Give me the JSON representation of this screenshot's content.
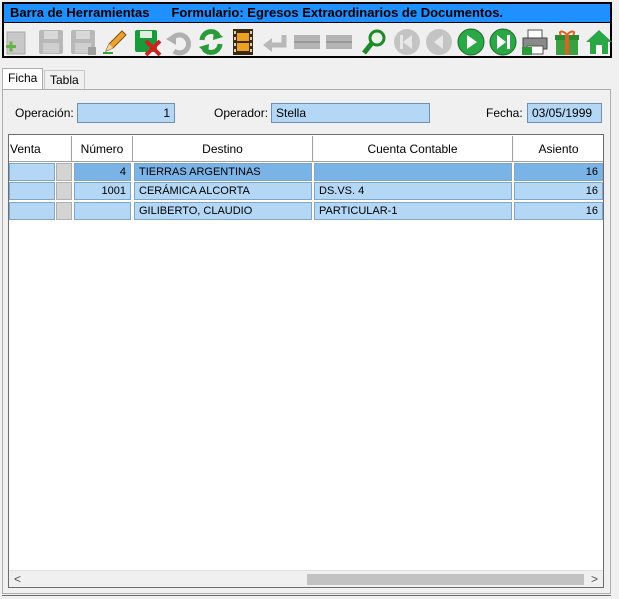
{
  "window": {
    "title_left": "Barra de Herramientas",
    "title_right": "Formulario: Egresos Extraordinarios de Documentos."
  },
  "toolbar": {
    "buttons": [
      {
        "name": "add-icon",
        "enabled": false
      },
      {
        "name": "save-icon",
        "enabled": false
      },
      {
        "name": "save-as-icon",
        "enabled": false
      },
      {
        "name": "edit-pencil-icon",
        "enabled": true
      },
      {
        "name": "delete-record-icon",
        "enabled": true
      },
      {
        "name": "undo-icon",
        "enabled": false
      },
      {
        "name": "refresh-icon",
        "enabled": true
      },
      {
        "name": "film-icon",
        "enabled": true
      },
      {
        "name": "return-icon",
        "enabled": false
      },
      {
        "name": "blank-1-icon",
        "enabled": false
      },
      {
        "name": "blank-2-icon",
        "enabled": false
      },
      {
        "name": "search-icon",
        "enabled": true
      },
      {
        "name": "first-record-icon",
        "enabled": false
      },
      {
        "name": "previous-record-icon",
        "enabled": false
      },
      {
        "name": "next-record-icon",
        "enabled": true
      },
      {
        "name": "last-record-icon",
        "enabled": true
      },
      {
        "name": "print-icon",
        "enabled": true
      },
      {
        "name": "gift-icon",
        "enabled": true
      },
      {
        "name": "home-icon",
        "enabled": true
      }
    ]
  },
  "tabs": [
    {
      "label": "Ficha",
      "active": true
    },
    {
      "label": "Tabla",
      "active": false
    }
  ],
  "form": {
    "operacion_label": "Operación:",
    "operacion_value": "1",
    "operador_label": "Operador:",
    "operador_value": "Stella",
    "fecha_label": "Fecha:",
    "fecha_value": "03/05/1999"
  },
  "grid": {
    "headers": [
      "Venta",
      "Número",
      "Destino",
      "Cuenta Contable",
      "Asiento"
    ],
    "rows": [
      {
        "venta": "",
        "numero": "4",
        "destino": "TIERRAS ARGENTINAS",
        "cuenta": "",
        "asiento": "16"
      },
      {
        "venta": "",
        "numero": "1001",
        "destino": "CERÁMICA ALCORTA",
        "cuenta": "DS.VS. 4",
        "asiento": "16"
      },
      {
        "venta": "",
        "numero": "",
        "destino": "GILIBERTO, CLAUDIO",
        "cuenta": "PARTICULAR-1",
        "asiento": "16"
      }
    ]
  },
  "scrollbar": {
    "left_arrow": "<",
    "right_arrow": ">"
  }
}
